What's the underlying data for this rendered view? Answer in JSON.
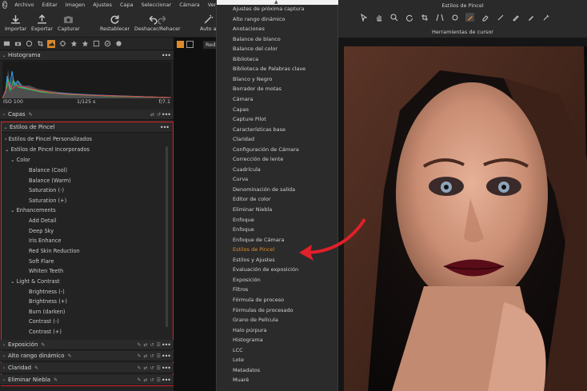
{
  "menubar": {
    "logo": "C",
    "items": [
      "Archivo",
      "Editar",
      "Imagen",
      "Ajustes",
      "Capa",
      "Seleccionar",
      "Cámara",
      "Ver"
    ]
  },
  "toolbar": {
    "importar": "Importar",
    "exportar": "Exportar",
    "capturar": "Capturar",
    "restablecer": "Restablecer",
    "deshacer_rehacer": "Deshacer/Rehacer",
    "auto_ajustar": "Auto a"
  },
  "left_panel": {
    "histogram": {
      "title": "Histograma",
      "iso": "ISO 100",
      "shutter": "1/125 s",
      "aperture": "f/7.1"
    },
    "capas": "Capas",
    "estilos": {
      "title": "Estilos de Pincel",
      "rows": [
        "Estilos de Pincel Personalizados",
        "Estilos de Pincel Incorporados",
        "Color",
        "Balance (Cool)",
        "Balance (Warm)",
        "Saturation (-)",
        "Saturation (+)",
        "Enhancements",
        "Add Detail",
        "Deep Sky",
        "Iris Enhance",
        "Red Skin Reduction",
        "Soft Flare",
        "Whiten Teeth",
        "Light & Contrast",
        "Brightness (-)",
        "Brightness (+)",
        "Burn (darken)",
        "Contrast (-)",
        "Contrast (+)"
      ]
    },
    "bottom_sections": [
      "Exposición",
      "Alto rango dinámico",
      "Claridad",
      "Eliminar Niebla"
    ]
  },
  "viewer_tab": "Red",
  "dropdown": {
    "selected": "Estilos de Pincel",
    "items": [
      "Ajustes de próxima captura",
      "Alto rango dinámico",
      "Anotaciones",
      "Balance de blanco",
      "Balance del color",
      "Biblioteca",
      "Biblioteca de Palabras clave",
      "Blanco y Negro",
      "Borrador de motas",
      "Cámara",
      "Capas",
      "Capture Pilot",
      "Características base",
      "Claridad",
      "Configuración de Cámara",
      "Corrección de lente",
      "Cuadrícula",
      "Curva",
      "Denominación de salida",
      "Editor de color",
      "Eliminar Niebla",
      "Enfoque",
      "Enfoque",
      "Enfoque de Cámara",
      "Estilos de Pincel",
      "Estilos y Ajustes",
      "Evaluación de exposición",
      "Exposición",
      "Filtros",
      "Fórmula de proceso",
      "Fórmulas de procesado",
      "Grano de Película",
      "Halo púrpura",
      "Histograma",
      "LCC",
      "Lote",
      "Metadatos",
      "Muaré"
    ]
  },
  "right_top": {
    "title": "Estilos de Pincel",
    "subtitle": "Herramientas de cursor"
  },
  "colors": {
    "accent": "#e08a2c",
    "highlight_red": "#d8232a",
    "panel_bg": "#232323"
  }
}
